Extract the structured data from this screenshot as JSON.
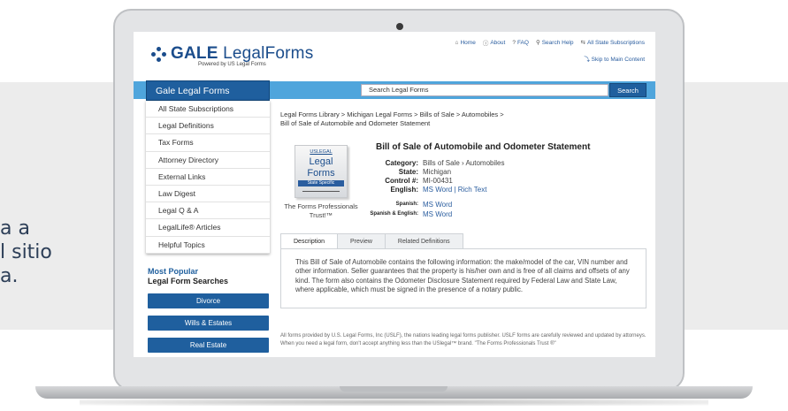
{
  "side_text": "a a\nl sitio\na.",
  "header": {
    "logo_brand": "GALE",
    "logo_product": "LegalForms",
    "logo_sub": "Powered by US Legal Forms",
    "nav": [
      {
        "icon": "home-icon",
        "glyph": "⌂",
        "label": "Home"
      },
      {
        "icon": "info-icon",
        "glyph": "ⓘ",
        "label": "About"
      },
      {
        "icon": "question-icon",
        "glyph": "?",
        "label": "FAQ"
      },
      {
        "icon": "search-icon",
        "glyph": "⚲",
        "label": "Search Help"
      },
      {
        "icon": "subscriptions-icon",
        "glyph": "⇆",
        "label": "All State Subscriptions"
      }
    ],
    "skip_label": "Skip to Main Content"
  },
  "bar": {
    "brand_tab": "Gale Legal Forms",
    "search_placeholder": "Search Legal Forms",
    "search_button": "Search"
  },
  "sidebar": {
    "items": [
      "All State Subscriptions",
      "Legal Definitions",
      "Tax Forms",
      "Attorney Directory",
      "External Links",
      "Law Digest",
      "Legal Q & A",
      "LegalLife® Articles",
      "Helpful Topics"
    ],
    "popular_line1": "Most Popular",
    "popular_line2": "Legal Form Searches",
    "popular_buttons": [
      "Divorce",
      "Wills & Estates",
      "Real Estate"
    ]
  },
  "breadcrumb": {
    "line": "Legal Forms Library  >  Michigan Legal Forms  >  Bills of Sale  >  Automobiles  >",
    "current": "Bill of Sale of Automobile and Odometer Statement"
  },
  "form_image": {
    "us": "USLEGAL",
    "big1": "Legal",
    "big2": "Forms",
    "strip": "State Specific"
  },
  "trust_text": "The Forms Professionals Trust!™",
  "document": {
    "title": "Bill of Sale of Automobile and Odometer Statement",
    "category_label": "Category:",
    "category_value": "Bills of Sale › Automobiles",
    "state_label": "State:",
    "state_value": "Michigan",
    "control_label": "Control #:",
    "control_value": "MI-00431",
    "english_label": "English:",
    "english_value": "MS Word | Rich Text",
    "spanish_label": "Spanish:",
    "spanish_value": "MS Word",
    "spanish_english_label": "Spanish & English:",
    "spanish_english_value": "MS Word"
  },
  "tabs": [
    "Description",
    "Preview",
    "Related Definitions"
  ],
  "description": "This Bill of Sale of Automobile contains the following information: the make/model of the car, VIN number and other information. Seller guarantees that the property is his/her own and is free of all claims and offsets of any kind. The form also contains the Odometer Disclosure Statement required by Federal Law and State Law, where applicable, which must be signed in the presence of a notary public.",
  "footer_note": "All forms provided by U.S. Legal Forms, Inc (USLF), the nations leading legal forms publisher. USLF forms are carefully reviewed and updated by attorneys. When you need a legal form, don't accept anything less than the USlegal™ brand. \"The Forms Professionals Trust ®\"",
  "colors": {
    "brand_blue": "#1f5f9e",
    "bar_blue": "#4fa5dc",
    "link_blue": "#2a5d9f"
  }
}
